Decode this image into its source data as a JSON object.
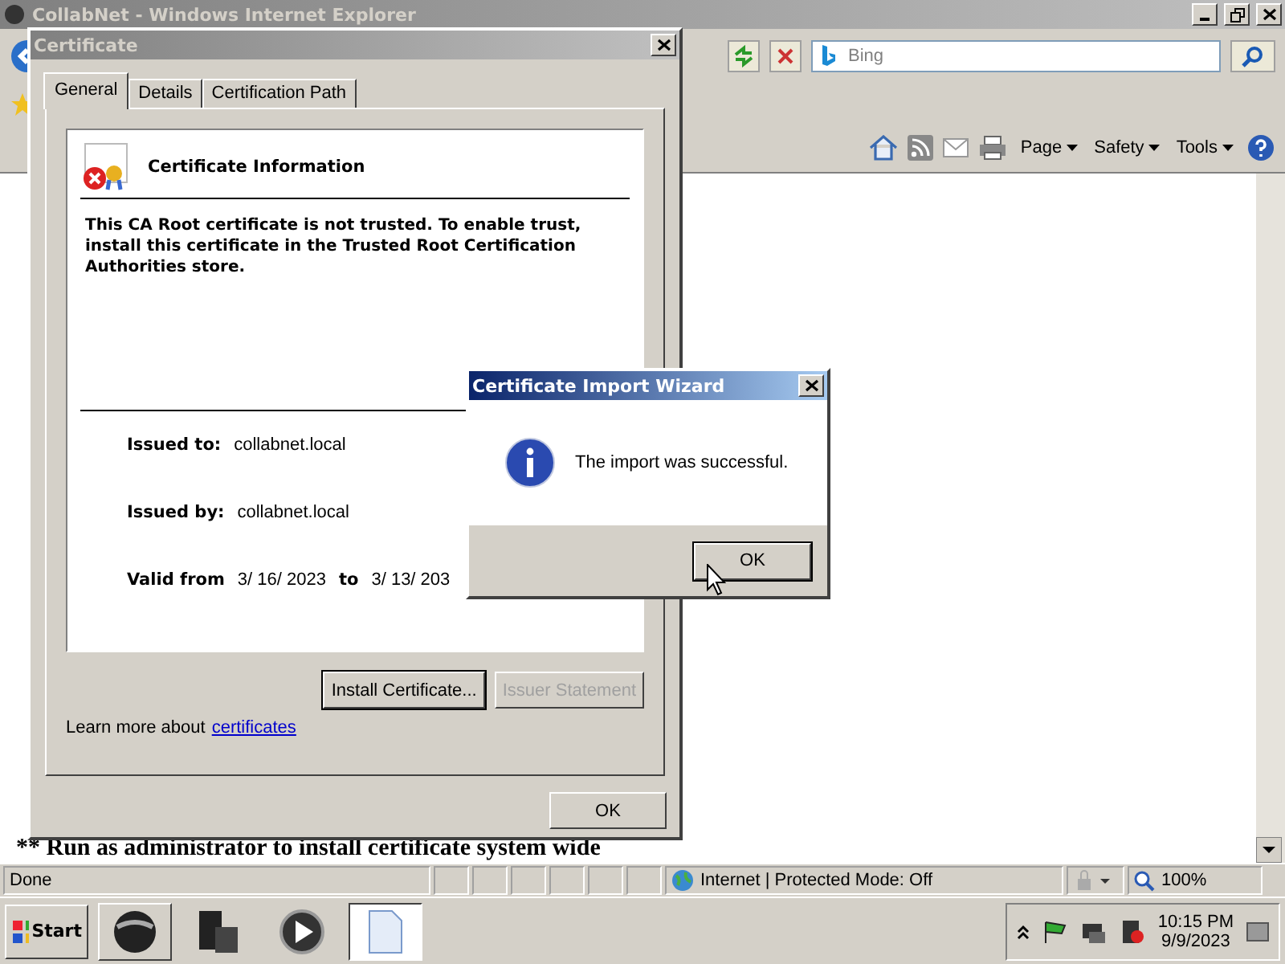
{
  "browser": {
    "title": "CollabNet - Windows Internet Explorer",
    "search_placeholder": "Bing",
    "commands": [
      "Page",
      "Safety",
      "Tools"
    ],
    "page_line": "** Run as administrator to install certificate system wide",
    "status": {
      "text": "Done",
      "zone": "Internet | Protected Mode: Off",
      "zoom": "100%"
    }
  },
  "certificate": {
    "title": "Certificate",
    "tabs": [
      {
        "label": "General",
        "selected": true
      },
      {
        "label": "Details",
        "selected": false
      },
      {
        "label": "Certification Path",
        "selected": false
      }
    ],
    "heading": "Certificate Information",
    "message": "This CA Root certificate is not trusted. To enable trust, install this certificate in the Trusted Root Certification Authorities store.",
    "fields": [
      {
        "label": "Issued to:",
        "value": "collabnet.local"
      },
      {
        "label": "Issued by:",
        "value": "collabnet.local"
      }
    ],
    "valid": {
      "label": "Valid from",
      "from": "3/ 16/ 2023",
      "to_label": "to",
      "to": "3/ 13/ 203"
    },
    "buttons": [
      {
        "label": "Install Certificate...",
        "disabled": false
      },
      {
        "label": "Issuer Statement",
        "disabled": true
      }
    ],
    "learn_more": {
      "text": "Learn more about",
      "link": "certificates"
    },
    "ok": "OK"
  },
  "wizard": {
    "title": "Certificate Import Wizard",
    "message": "The import was successful.",
    "button": "OK"
  },
  "taskbar": {
    "start": "Start",
    "time": "10:15 PM",
    "date": "9/9/2023"
  }
}
